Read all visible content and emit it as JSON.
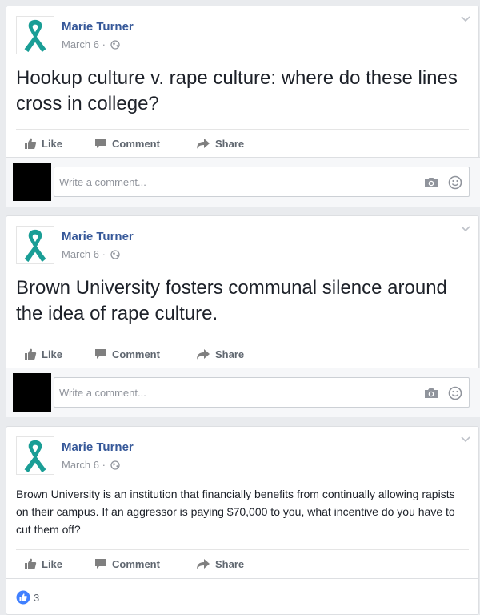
{
  "posts": [
    {
      "author": "Marie Turner",
      "date": "March 6",
      "separator": "·",
      "text": "Hookup culture v. rape culture: where do these lines cross in college?",
      "actions": {
        "like": "Like",
        "comment": "Comment",
        "share": "Share"
      },
      "comment_placeholder": "Write a comment..."
    },
    {
      "author": "Marie Turner",
      "date": "March 6",
      "separator": "·",
      "text": "Brown University fosters communal silence around the idea of rape culture.",
      "actions": {
        "like": "Like",
        "comment": "Comment",
        "share": "Share"
      },
      "comment_placeholder": "Write a comment..."
    },
    {
      "author": "Marie Turner",
      "date": "March 6",
      "separator": "·",
      "text": "Brown University is an institution that financially benefits from continually allowing rapists on their campus. If an aggressor is paying $70,000 to you, what incentive do you have to cut them off?",
      "actions": {
        "like": "Like",
        "comment": "Comment",
        "share": "Share"
      },
      "like_count": "3"
    }
  ],
  "colors": {
    "author_link": "#365899",
    "ribbon": "#1a9e96",
    "like_badge": "#4080ff"
  },
  "icons": [
    "awareness-ribbon-icon",
    "globe-icon",
    "chevron-down-icon",
    "thumbs-up-icon",
    "comment-icon",
    "share-icon",
    "camera-icon",
    "smiley-icon"
  ]
}
